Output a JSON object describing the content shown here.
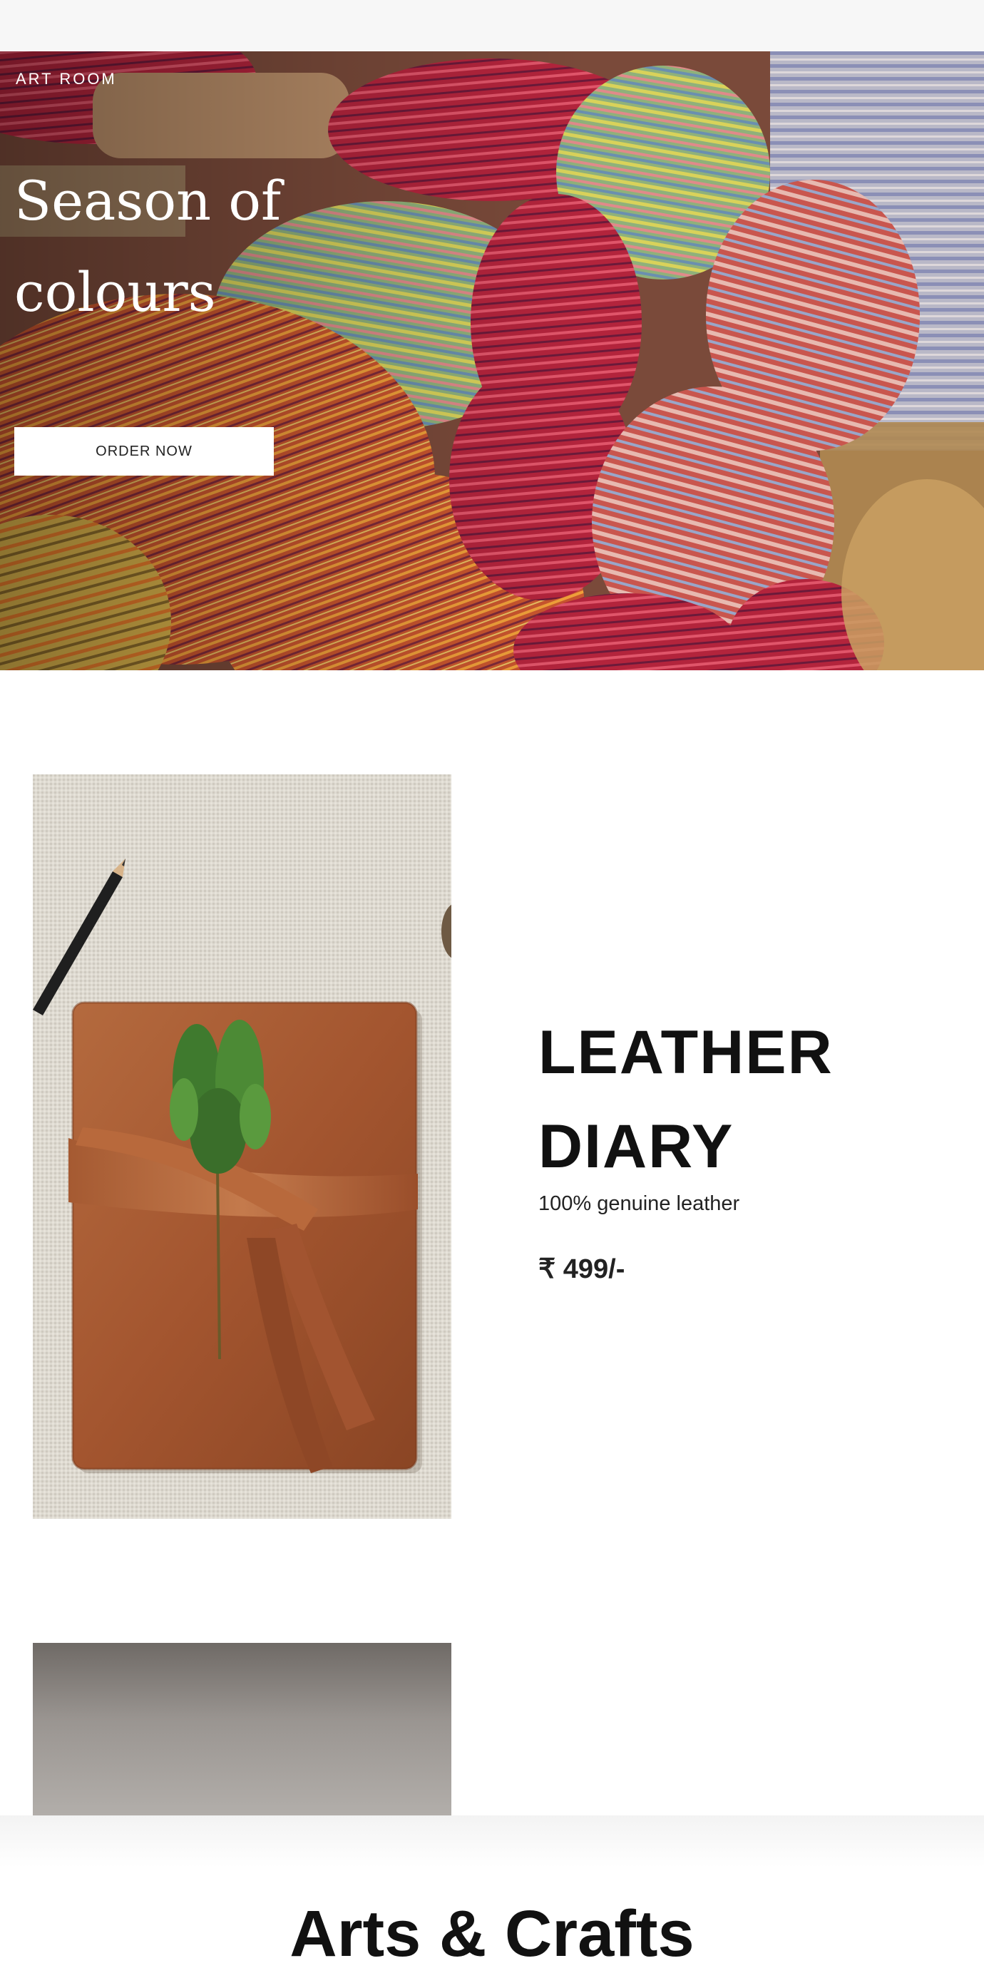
{
  "hero": {
    "brand": "ART ROOM",
    "title_line1": "Season of",
    "title_line2": "colours",
    "cta_label": "ORDER NOW"
  },
  "product": {
    "name_line1": "LEATHER",
    "name_line2": "DIARY",
    "description": "100% genuine leather",
    "price": "₹ 499/-"
  },
  "section": {
    "title": "Arts & Crafts"
  },
  "colors": {
    "background": "#ffffff",
    "leather": "#a55a32",
    "cta_background": "#ffffff"
  },
  "icons": [
    "pencil-icon",
    "leaf-sprig-icon"
  ]
}
